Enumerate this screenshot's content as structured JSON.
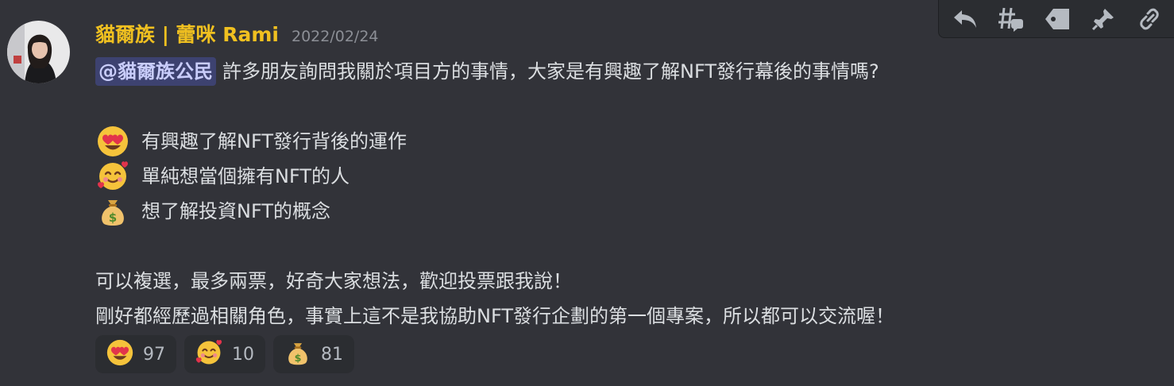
{
  "author": {
    "name": "貓爾族 | 蕾咪 Rami",
    "name_color": "#f0c020",
    "timestamp": "2022/02/24"
  },
  "message": {
    "mention": "@貓爾族公民",
    "line1": "許多朋友詢問我關於項目方的事情，大家是有興趣了解NFT發行幕後的事情嗎?",
    "options": [
      {
        "icon": "heart-eyes-emoji",
        "text": "有興趣了解NFT發行背後的運作"
      },
      {
        "icon": "smiling-face-with-hearts-emoji",
        "text": "單純想當個擁有NFT的人"
      },
      {
        "icon": "money-bag-emoji",
        "text": "想了解投資NFT的概念"
      }
    ],
    "line5": "可以複選，最多兩票，好奇大家想法，歡迎投票跟我說！",
    "line6": "剛好都經歷過相關角色，事實上這不是我協助NFT發行企劃的第一個專案，所以都可以交流喔！"
  },
  "reactions": [
    {
      "icon": "heart-eyes-emoji",
      "count": "97"
    },
    {
      "icon": "smiling-face-with-hearts-emoji",
      "count": "10"
    },
    {
      "icon": "money-bag-emoji",
      "count": "81"
    }
  ],
  "toolbar": {
    "icons": [
      "reply-icon",
      "create-thread-icon",
      "tag-icon",
      "pin-icon",
      "copy-link-icon"
    ]
  },
  "colors": {
    "background": "#323339",
    "mention_bg": "#3d4270",
    "mention_text": "#c9cdfb",
    "text": "#dbdee1",
    "muted": "#8c8f96"
  }
}
